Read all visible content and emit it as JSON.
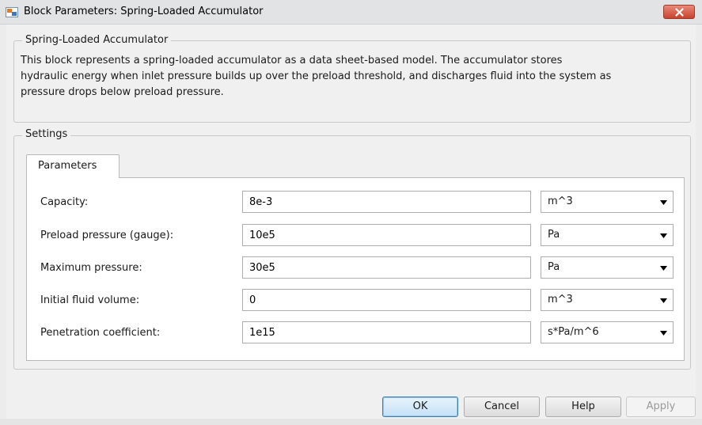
{
  "window": {
    "title": "Block Parameters: Spring-Loaded Accumulator",
    "close_label": "close"
  },
  "block": {
    "name": "Spring-Loaded Accumulator",
    "description_lines": [
      "This block represents a spring-loaded accumulator as a data sheet-based model. The accumulator stores",
      "hydraulic energy when inlet pressure builds up over the preload threshold, and discharges fluid into the system as",
      "pressure drops below preload pressure."
    ]
  },
  "settings": {
    "label": "Settings",
    "tabs": [
      {
        "label": "Parameters",
        "active": true
      }
    ],
    "params": [
      {
        "label": "Capacity:",
        "value": "8e-3",
        "unit": "m^3"
      },
      {
        "label": "Preload pressure (gauge):",
        "value": "10e5",
        "unit": "Pa"
      },
      {
        "label": "Maximum pressure:",
        "value": "30e5",
        "unit": "Pa"
      },
      {
        "label": "Initial fluid volume:",
        "value": "0",
        "unit": "m^3"
      },
      {
        "label": "Penetration coefficient:",
        "value": "1e15",
        "unit": "s*Pa/m^6"
      }
    ]
  },
  "buttons": {
    "ok": "OK",
    "cancel": "Cancel",
    "help": "Help",
    "apply": "Apply"
  },
  "colors": {
    "close_button": "#c7432d",
    "ok_button_border": "#3c7fb1",
    "dialog_bg": "#f0f0f0"
  },
  "icons": {
    "app": "simulink-block-icon",
    "close": "close-icon",
    "dropdown": "chevron-down-icon"
  }
}
